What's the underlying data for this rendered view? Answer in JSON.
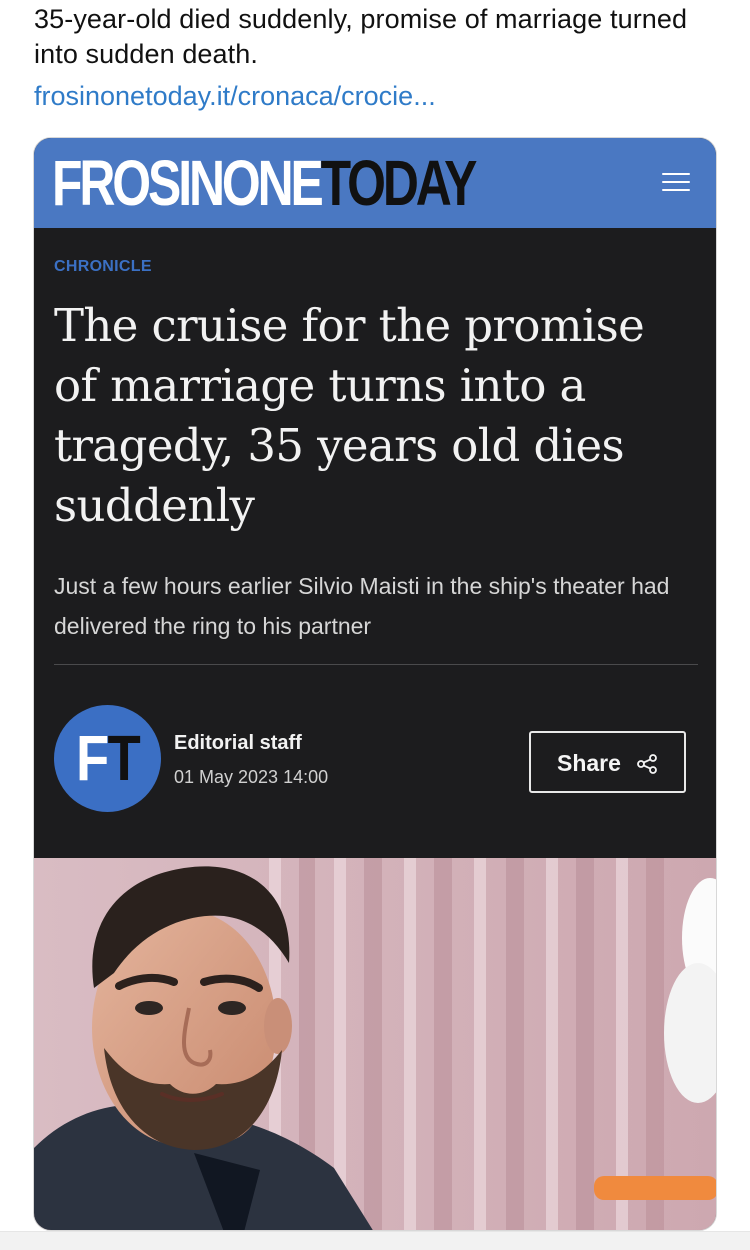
{
  "tweet": {
    "headline": "35-year-old died suddenly, promise of marriage turned into sudden death.",
    "link_text": "frosinonetoday.it/cronaca/crocie..."
  },
  "site": {
    "logo_part_1": "FROSINONE",
    "logo_part_2": "TODAY",
    "menu_icon": "hamburger-menu-icon",
    "header_color": "#4a78c2"
  },
  "article": {
    "category": "CHRONICLE",
    "title": "The cruise for the promise of marriage turns into a tragedy, 35 years old dies suddenly",
    "subtitle": "Just a few hours earlier Silvio Maisti in the ship's theater had delivered the ring to his partner",
    "author": {
      "initials_part_1": "F",
      "initials_part_2": "T",
      "name": "Editorial staff",
      "date": "01 May 2023 14:00"
    },
    "share_label": "Share",
    "share_icon": "share-icon"
  },
  "colors": {
    "accent_blue": "#3b70c4",
    "link_blue": "#2f7bc8",
    "dark_background": "#1c1c1e"
  }
}
